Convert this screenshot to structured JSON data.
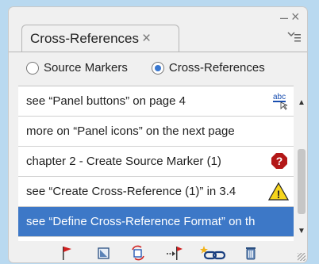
{
  "panel": {
    "tab_label": "Cross-References",
    "tab_close": "×",
    "close_button": "×",
    "minimize_button": "–"
  },
  "radios": {
    "source_markers": {
      "label": "Source Markers",
      "selected": false
    },
    "cross_references": {
      "label": "Cross-References",
      "selected": true
    }
  },
  "list": {
    "items": [
      {
        "text": "see “Panel buttons” on page 4",
        "icon": "spell-check-icon"
      },
      {
        "text": "more on “Panel icons” on the next page",
        "icon": ""
      },
      {
        "text": "chapter 2 - Create Source Marker (1)",
        "icon": "help-icon"
      },
      {
        "text": "see “Create Cross-Reference (1)” in 3.4",
        "icon": "warning-icon"
      },
      {
        "text": "see “Define Cross-Reference Format” on th",
        "icon": "",
        "selected": true
      }
    ]
  },
  "toolbar": {
    "icons": [
      "flag-icon",
      "box-icon",
      "refresh-icon",
      "flag-arrow-icon",
      "link-icon",
      "trash-icon"
    ]
  },
  "colors": {
    "background": "#b9d9f0",
    "selection": "#3d78c7"
  }
}
